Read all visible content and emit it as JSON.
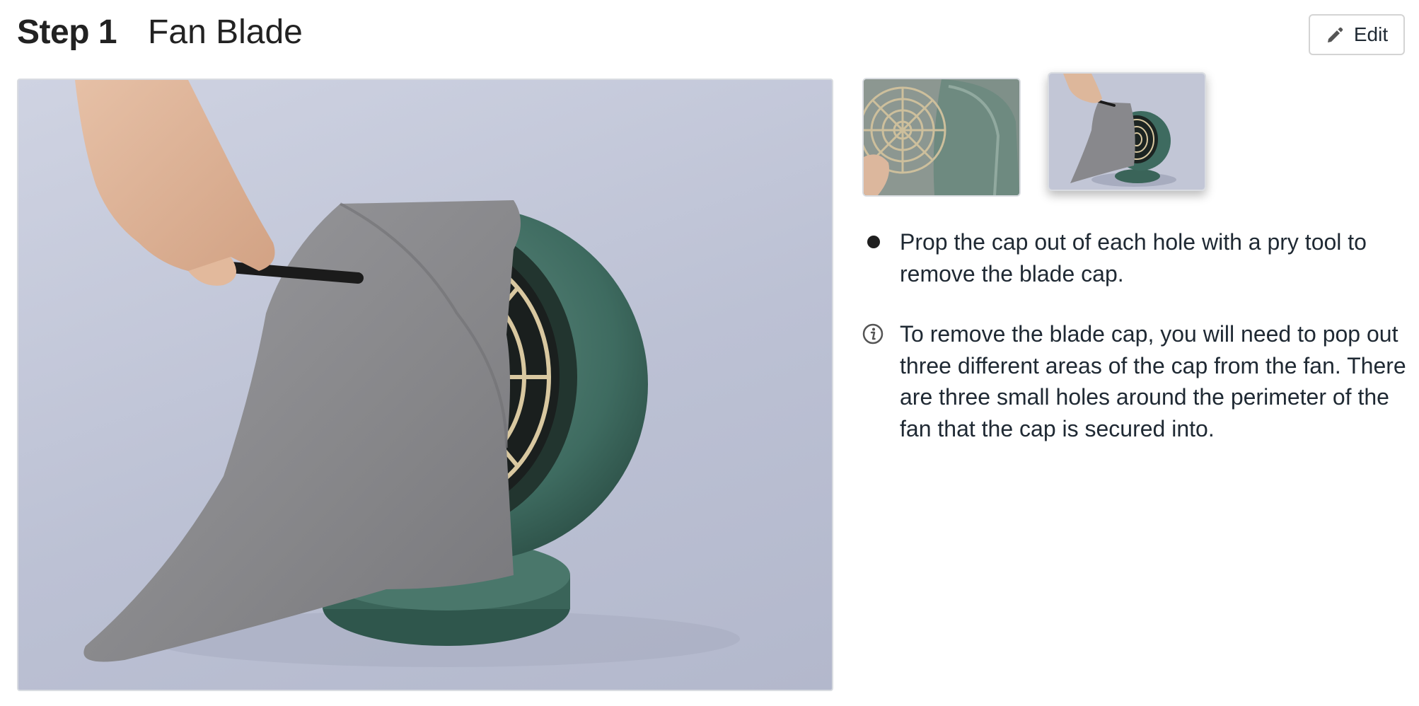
{
  "header": {
    "step_number": "Step 1",
    "step_title": "Fan Blade"
  },
  "toolbar": {
    "edit_label": "Edit",
    "edit_icon": "pencil-icon"
  },
  "media": {
    "main_image_description_icon": "photo",
    "thumbnails": [
      {
        "icon": "photo",
        "selected": false
      },
      {
        "icon": "photo",
        "selected": true
      }
    ]
  },
  "instructions": {
    "lines": [
      {
        "type": "bullet",
        "icon": "bullet-dot-icon",
        "text": "Prop the cap out of each hole with a pry tool to remove the blade cap."
      },
      {
        "type": "note",
        "icon": "info-icon",
        "text": "To remove the blade cap, you will need to pop out three different areas of the cap from the fan. There are three small holes around the perimeter of the fan that the cap is secured into."
      }
    ]
  },
  "colors": {
    "fan_body": "#3e6b60",
    "towel": "#8a8a8e",
    "background_photo": "#c4c8d8",
    "grill": "#d9c8a0"
  }
}
